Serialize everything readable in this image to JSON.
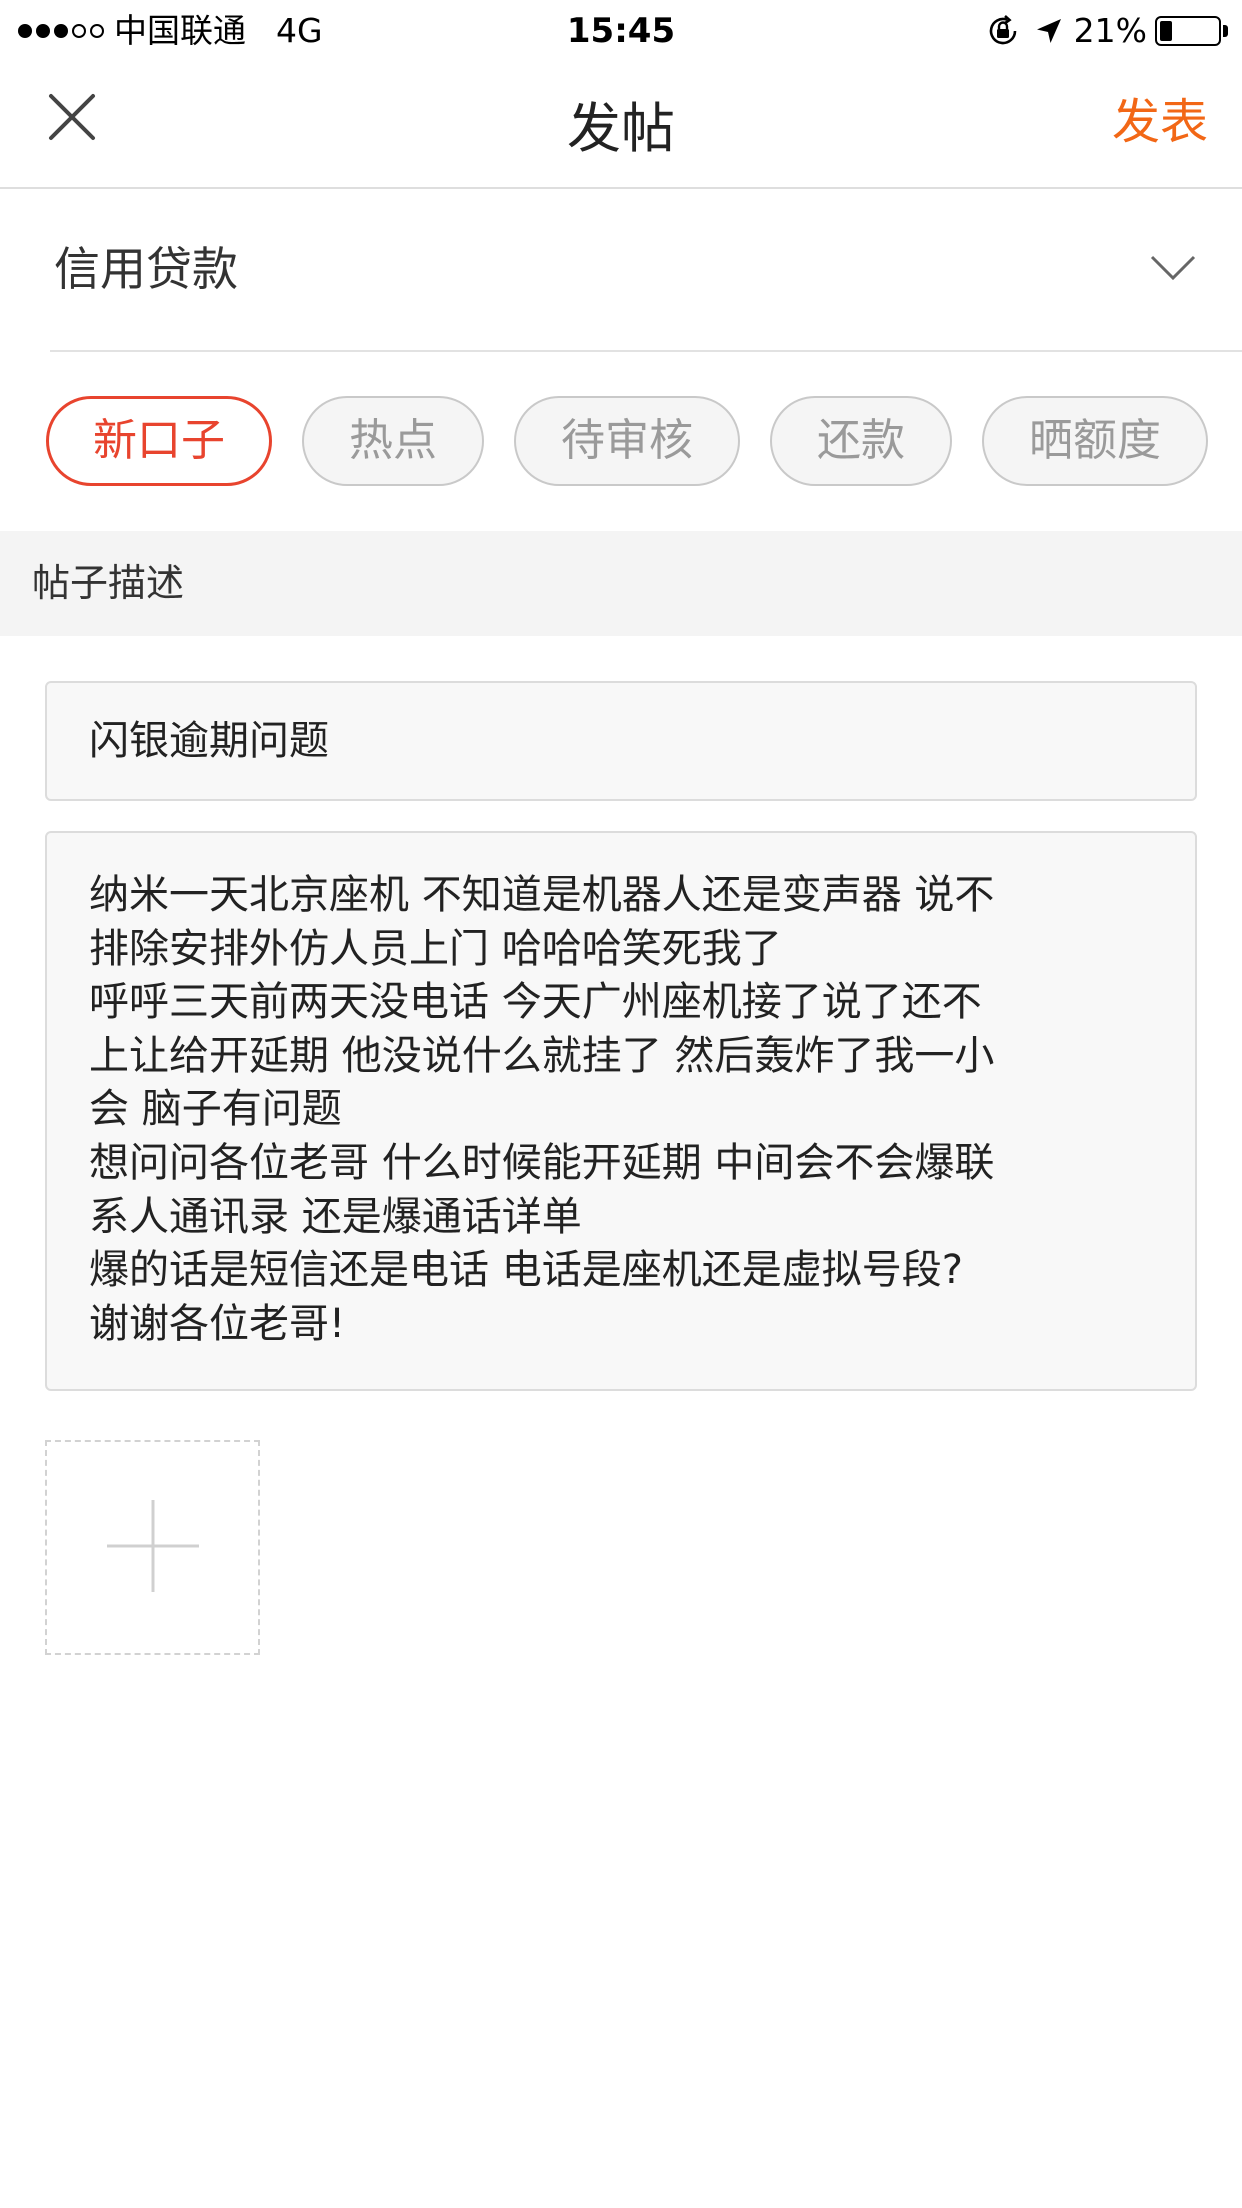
{
  "status_bar": {
    "carrier": "中国联通",
    "network": "4G",
    "time": "15:45",
    "battery_percent": "21%",
    "battery_level": 0.21,
    "signal_bars_filled": 3,
    "signal_bars_total": 5,
    "icons": [
      "orientation-lock-icon",
      "location-arrow-icon",
      "battery-icon"
    ]
  },
  "nav": {
    "close_icon": "close-icon",
    "title": "发帖",
    "publish_label": "发表"
  },
  "category": {
    "selected": "信用贷款",
    "chevron_icon": "chevron-down-icon"
  },
  "tags": [
    {
      "label": "新口子",
      "active": true
    },
    {
      "label": "热点",
      "active": false
    },
    {
      "label": "待审核",
      "active": false
    },
    {
      "label": "还款",
      "active": false
    },
    {
      "label": "晒额度",
      "active": false
    }
  ],
  "section": {
    "title": "帖子描述"
  },
  "post": {
    "title_value": "闪银逾期问题",
    "body_lines": [
      "纳米一天北京座机 不知道是机器人还是变声器 说不",
      "排除安排外仿人员上门 哈哈哈笑死我了",
      "呼呼三天前两天没电话 今天广州座机接了说了还不",
      "上让给开延期 他没说什么就挂了 然后轰炸了我一小",
      "会 脑子有问题",
      "想问问各位老哥 什么时候能开延期 中间会不会爆联",
      "系人通讯录 还是爆通话详单",
      "爆的话是短信还是电话 电话是座机还是虚拟号段?",
      "谢谢各位老哥!"
    ]
  },
  "add_image": {
    "icon": "plus-icon"
  },
  "colors": {
    "accent_orange": "#f26716",
    "tag_active_red": "#e8442e",
    "tag_inactive_text": "#9a9a9a",
    "section_bg": "#f4f4f4"
  }
}
